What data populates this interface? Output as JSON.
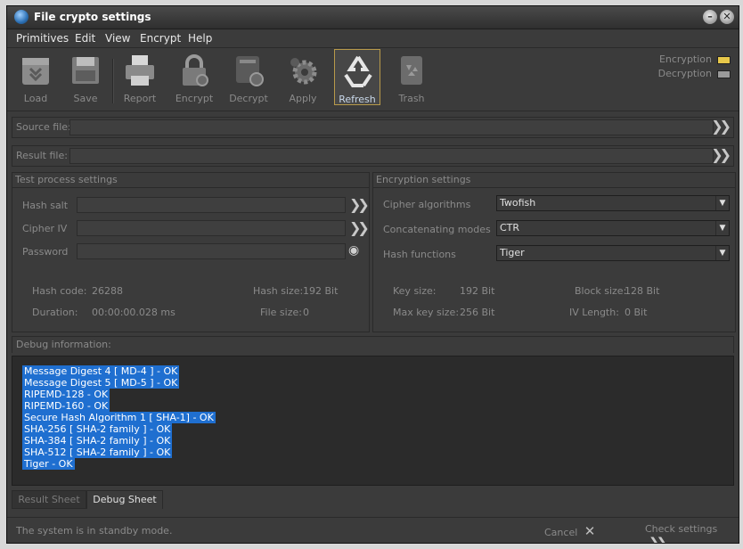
{
  "window": {
    "title": "File crypto settings"
  },
  "menu": [
    "Primitives",
    "Edit",
    "View",
    "Encrypt",
    "Help"
  ],
  "toolbar": {
    "load": "Load",
    "save": "Save",
    "report": "Report",
    "encrypt": "Encrypt",
    "decrypt": "Decrypt",
    "apply": "Apply",
    "refresh": "Refresh",
    "trash": "Trash"
  },
  "indicators": {
    "encryption": "Encryption",
    "decryption": "Decryption",
    "encryption_color": "#e8c84a",
    "decryption_color": "#9a9a9a"
  },
  "files": {
    "source_label": "Source file:",
    "source_value": "",
    "result_label": "Result file:",
    "result_value": ""
  },
  "test_process": {
    "title": "Test process settings",
    "hash_salt_label": "Hash salt",
    "hash_salt_value": "",
    "cipher_iv_label": "Cipher IV",
    "cipher_iv_value": "",
    "password_label": "Password",
    "password_value": "",
    "hash_code_label": "Hash code:",
    "hash_code_value": "26288",
    "duration_label": "Duration:",
    "duration_value": "00:00:00.028 ms",
    "hash_size_label": "Hash size:",
    "hash_size_value": "192 Bit",
    "file_size_label": "File size:",
    "file_size_value": "0"
  },
  "encryption_settings": {
    "title": "Encryption settings",
    "cipher_label": "Cipher algorithms",
    "cipher_value": "Twofish",
    "modes_label": "Concatenating modes",
    "modes_value": "CTR",
    "hash_label": "Hash functions",
    "hash_value": "Tiger",
    "key_size_label": "Key size:",
    "key_size_value": "192 Bit",
    "max_key_label": "Max key size:",
    "max_key_value": "256 Bit",
    "block_size_label": "Block size:",
    "block_size_value": "128 Bit",
    "iv_length_label": "IV Length:",
    "iv_length_value": "0 Bit"
  },
  "debug": {
    "title": "Debug information:",
    "lines": [
      "Message Digest 4 [ MD-4 ] - OK",
      "Message Digest 5 [ MD-5 ] - OK",
      "RIPEMD-128 - OK",
      "RIPEMD-160 - OK",
      "Secure Hash Algorithm 1 [ SHA-1] - OK",
      "SHA-256 [ SHA-2 family ] - OK",
      "SHA-384 [ SHA-2 family ] - OK",
      "SHA-512 [ SHA-2 family ] - OK",
      "Tiger - OK"
    ]
  },
  "tabs": {
    "result": "Result Sheet",
    "debug": "Debug Sheet"
  },
  "status": {
    "message": "The system is in standby mode.",
    "cancel": "Cancel",
    "check": "Check settings"
  }
}
